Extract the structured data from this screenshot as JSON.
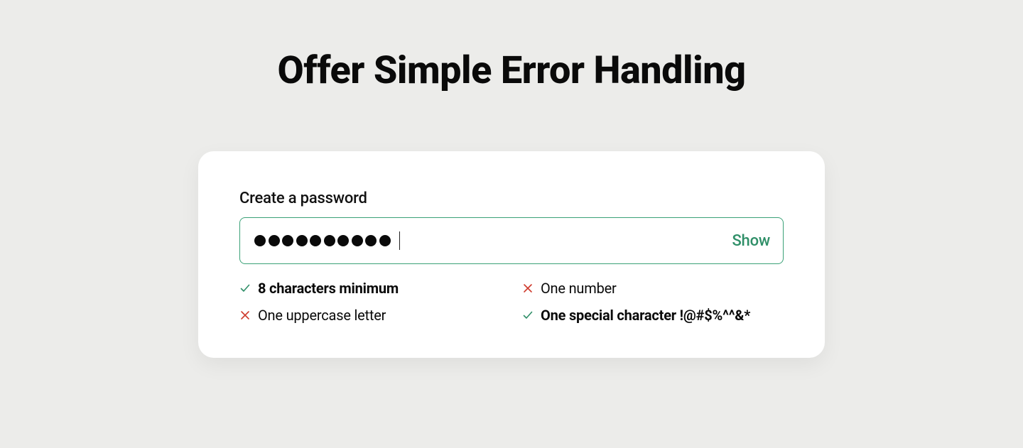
{
  "heading": "Offer Simple Error Handling",
  "form": {
    "label": "Create a password",
    "dot_count": 10,
    "show_label": "Show"
  },
  "colors": {
    "accent": "#3aa177",
    "success": "#2f8f68",
    "error": "#cf3b2e"
  },
  "rules": [
    {
      "text": "8 characters minimum",
      "met": true
    },
    {
      "text": "One number",
      "met": false
    },
    {
      "text": "One uppercase letter",
      "met": false
    },
    {
      "text": "One special character !@#$%^^&*",
      "met": true
    }
  ]
}
